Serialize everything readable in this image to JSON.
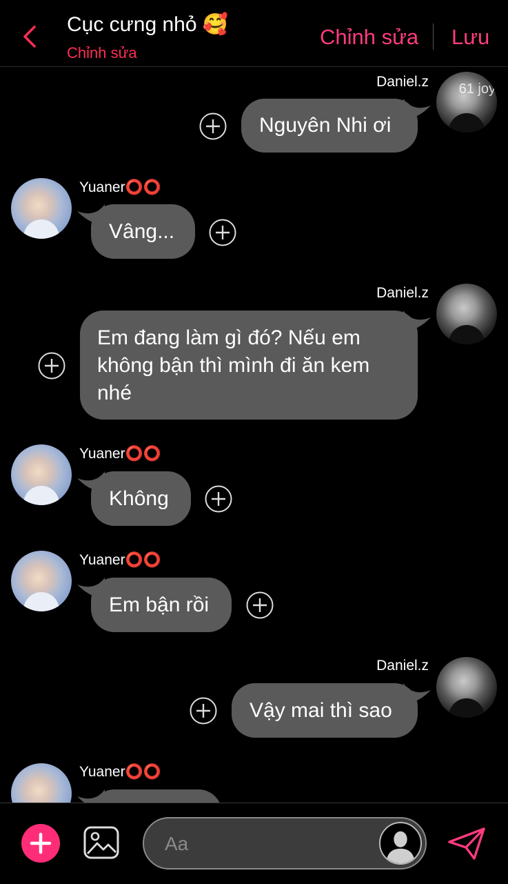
{
  "header": {
    "title": "Cục cưng nhỏ 🥰",
    "subtitle": "Chỉnh sửa",
    "edit_label": "Chỉnh sửa",
    "save_label": "Lưu"
  },
  "messages": [
    {
      "sender": "Daniel.z",
      "side": "right",
      "text": "Nguyên Nhi ơi",
      "avatar_watermark": "61 joy"
    },
    {
      "sender": "Yuaner⭕⭕",
      "side": "left",
      "text": "Vâng..."
    },
    {
      "sender": "Daniel.z",
      "side": "right",
      "lines": [
        "Em đang làm gì đó? Nếu em",
        "không bận thì mình đi ăn kem",
        "nhé"
      ]
    },
    {
      "sender": "Yuaner⭕⭕",
      "side": "left",
      "text": "Không"
    },
    {
      "sender": "Yuaner⭕⭕",
      "side": "left",
      "text": "Em bận rồi"
    },
    {
      "sender": "Daniel.z",
      "side": "right",
      "text": "Vậy mai thì sao"
    },
    {
      "sender": "Yuaner⭕⭕",
      "side": "left",
      "text": ""
    }
  ],
  "composer": {
    "placeholder": "Aa",
    "add_icon": "plus-icon",
    "image_icon": "image-icon",
    "send_icon": "send-icon"
  },
  "colors": {
    "accent": "#ff3b7f",
    "bubble": "#5a5a5a",
    "background": "#000000"
  }
}
